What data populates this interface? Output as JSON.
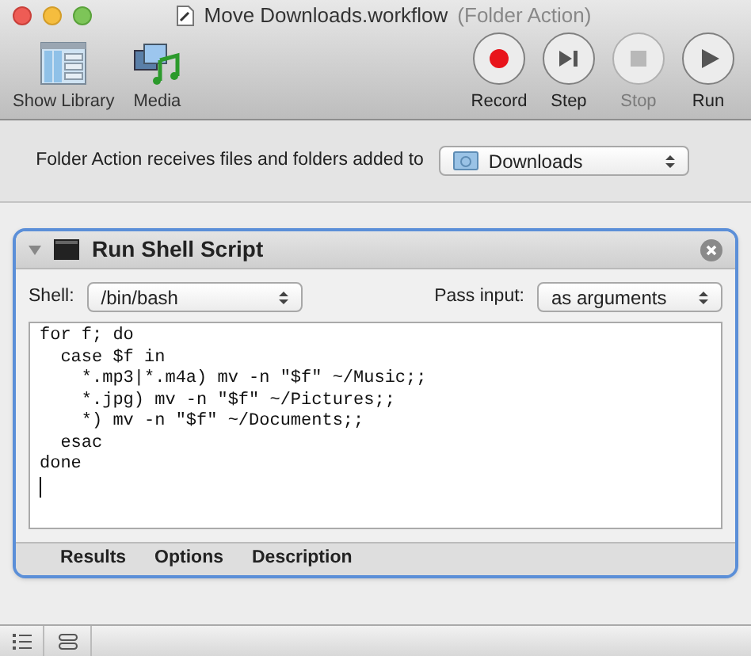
{
  "window": {
    "title": "Move Downloads.workflow",
    "subtitle": "(Folder Action)"
  },
  "toolbar_left": [
    {
      "kind": "library",
      "label": "Show Library"
    },
    {
      "kind": "media",
      "label": "Media"
    }
  ],
  "toolbar_right": [
    {
      "kind": "record",
      "label": "Record",
      "disabled": false
    },
    {
      "kind": "step",
      "label": "Step",
      "disabled": false
    },
    {
      "kind": "stop",
      "label": "Stop",
      "disabled": true
    },
    {
      "kind": "run",
      "label": "Run",
      "disabled": false
    }
  ],
  "folder_action": {
    "label": "Folder Action receives files and folders added to",
    "folder": "Downloads"
  },
  "action": {
    "title": "Run Shell Script",
    "expanded": true,
    "shell_label": "Shell:",
    "shell": "/bin/bash",
    "pass_label": "Pass input:",
    "pass": "as arguments",
    "script": [
      "for f; do",
      "  case $f in",
      "    *.mp3|*.m4a) mv -n \"$f\" ~/Music;;",
      "    *.jpg) mv -n \"$f\" ~/Pictures;;",
      "    *) mv -n \"$f\" ~/Documents;;",
      "  esac",
      "done"
    ],
    "footer_tabs": [
      "Results",
      "Options",
      "Description"
    ]
  }
}
